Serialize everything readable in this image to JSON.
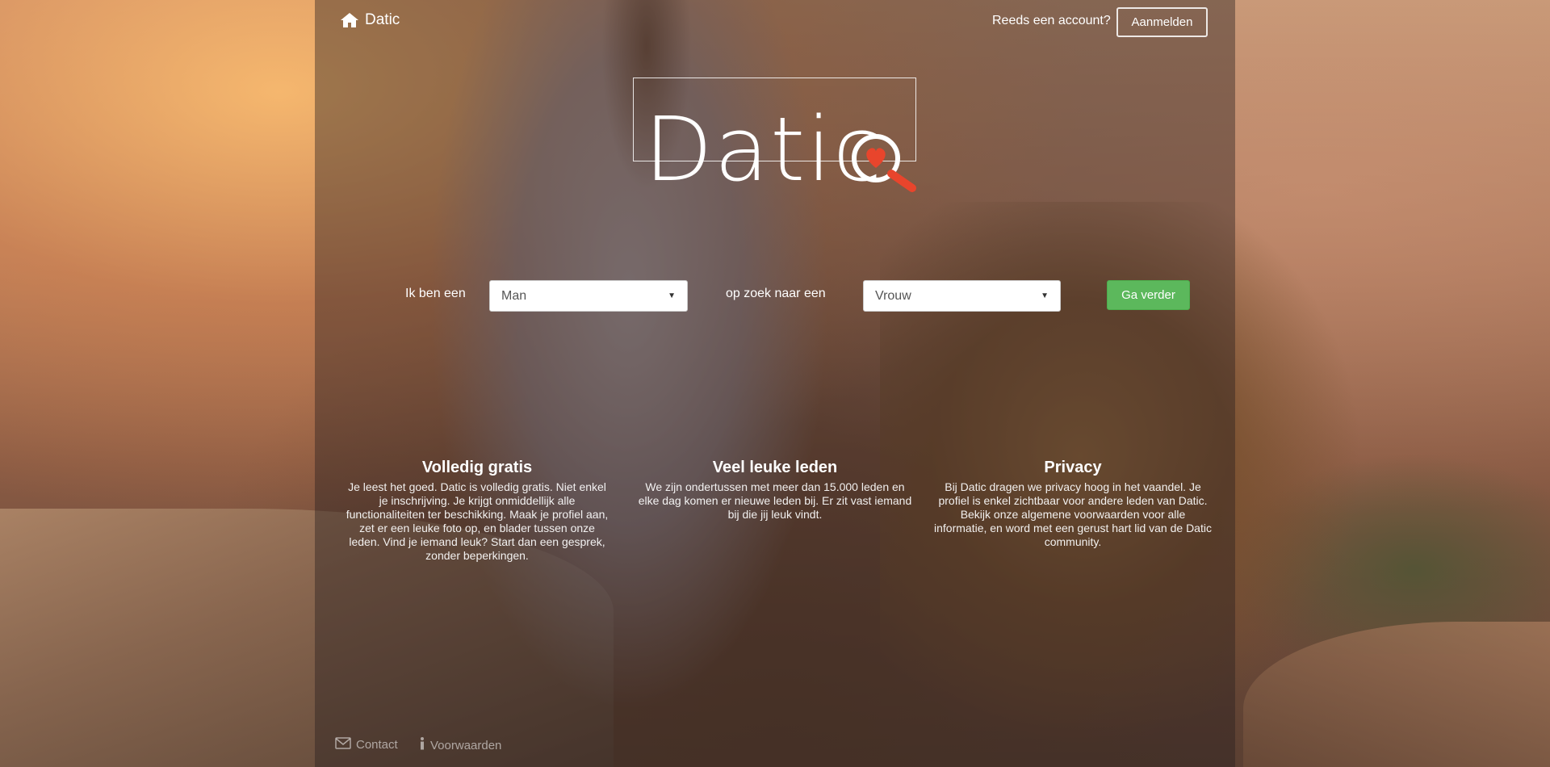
{
  "header": {
    "brand_label": "Datic",
    "brand_icon": "home-icon",
    "account_question": "Reeds een account?",
    "login_label": "Aanmelden"
  },
  "logo": {
    "text": "Datic",
    "accent_color": "#e8452c"
  },
  "search": {
    "i_am_label": "Ik ben een",
    "i_am_value": "Man",
    "looking_for_label": "op zoek naar een",
    "looking_for_value": "Vrouw",
    "submit_label": "Ga verder"
  },
  "features": [
    {
      "title": "Volledig gratis",
      "text": "Je leest het goed. Datic is volledig gratis. Niet enkel je inschrijving. Je krijgt onmiddellijk alle functionaliteiten ter beschikking. Maak je profiel aan, zet er een leuke foto op, en blader tussen onze leden. Vind je iemand leuk? Start dan een gesprek, zonder beperkingen."
    },
    {
      "title": "Veel leuke leden",
      "text": "We zijn ondertussen met meer dan 15.000 leden en elke dag komen er nieuwe leden bij. Er zit vast iemand bij die jij leuk vindt."
    },
    {
      "title": "Privacy",
      "text": "Bij Datic dragen we privacy hoog in het vaandel. Je profiel is enkel zichtbaar voor andere leden van Datic. Bekijk onze algemene voorwaarden voor alle informatie, en word met een gerust hart lid van de Datic community."
    }
  ],
  "footer": {
    "contact_label": "Contact",
    "terms_label": "Voorwaarden"
  },
  "colors": {
    "primary_button": "#5cb85c",
    "overlay": "#28201e"
  }
}
